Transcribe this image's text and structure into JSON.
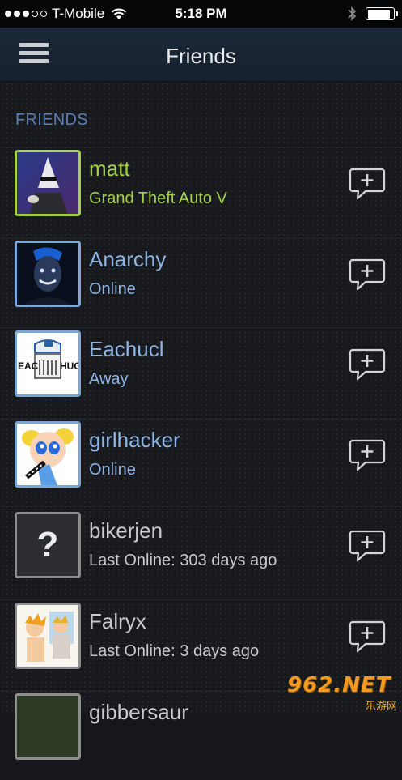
{
  "status_bar": {
    "carrier": "T-Mobile",
    "time": "5:18 PM",
    "signal_bars_filled": 3,
    "signal_bars_total": 5,
    "battery_level": 0.9,
    "icons": [
      "signal-dots-icon",
      "wifi-icon",
      "bluetooth-icon",
      "battery-icon"
    ]
  },
  "navbar": {
    "title": "Friends",
    "menu_icon": "hamburger-menu-icon"
  },
  "section": {
    "title": "FRIENDS"
  },
  "friends": [
    {
      "name": "matt",
      "status": "Grand Theft Auto V",
      "state": "ingame"
    },
    {
      "name": "Anarchy",
      "status": "Online",
      "state": "online"
    },
    {
      "name": "Eachucl",
      "status": "Away",
      "state": "online",
      "avatar_text_left": "EAC",
      "avatar_text_right": "HUC"
    },
    {
      "name": "girlhacker",
      "status": "Online",
      "state": "online"
    },
    {
      "name": "bikerjen",
      "status": "Last Online: 303 days ago",
      "state": "offline",
      "avatar_glyph": "?"
    },
    {
      "name": "Falryx",
      "status": "Last Online: 3 days ago",
      "state": "offline"
    },
    {
      "name": "gibbersaur",
      "status": "",
      "state": "offline"
    }
  ],
  "colors": {
    "navbar_bg": "#1b2838",
    "section_header": "#5a7fb3",
    "ingame": "#a4d147",
    "online": "#8db5e5",
    "offline": "#c9cacc",
    "background": "#18191c"
  },
  "watermark": {
    "top": "962.NET",
    "bottom": "乐游网"
  }
}
